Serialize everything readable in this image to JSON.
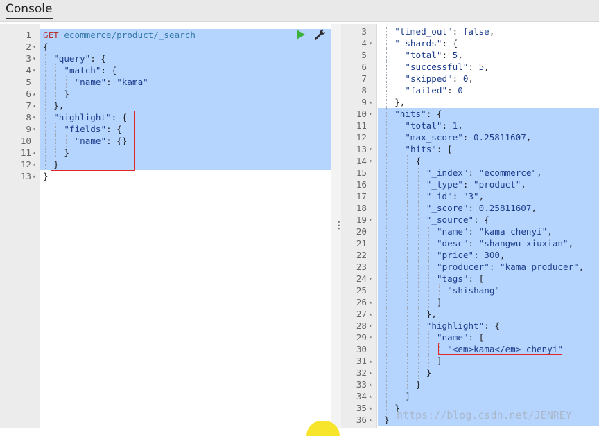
{
  "tab": {
    "label": "Console"
  },
  "request": {
    "lines": [
      {
        "n": "1",
        "fold": "",
        "indent": 0,
        "segs": [
          [
            "m",
            "GET"
          ],
          [
            "b",
            " "
          ],
          [
            "u",
            "ecommerce/product/_search"
          ]
        ],
        "active": true
      },
      {
        "n": "2",
        "fold": "▾",
        "indent": 0,
        "segs": [
          [
            "b",
            "{"
          ]
        ]
      },
      {
        "n": "3",
        "fold": "▾",
        "indent": 1,
        "segs": [
          [
            "k",
            "\"query\""
          ],
          [
            "b",
            ": {"
          ]
        ]
      },
      {
        "n": "4",
        "fold": "▾",
        "indent": 2,
        "segs": [
          [
            "k",
            "\"match\""
          ],
          [
            "b",
            ": {"
          ]
        ]
      },
      {
        "n": "5",
        "fold": "",
        "indent": 3,
        "segs": [
          [
            "k",
            "\"name\""
          ],
          [
            "b",
            ": "
          ],
          [
            "s",
            "\"kama\""
          ]
        ]
      },
      {
        "n": "6",
        "fold": "▴",
        "indent": 2,
        "segs": [
          [
            "b",
            "}"
          ]
        ]
      },
      {
        "n": "7",
        "fold": "▴",
        "indent": 1,
        "segs": [
          [
            "b",
            "},"
          ]
        ]
      },
      {
        "n": "8",
        "fold": "▾",
        "indent": 1,
        "segs": [
          [
            "k",
            "\"highlight\""
          ],
          [
            "b",
            ": {"
          ]
        ]
      },
      {
        "n": "9",
        "fold": "▾",
        "indent": 2,
        "segs": [
          [
            "k",
            "\"fields\""
          ],
          [
            "b",
            ": {"
          ]
        ]
      },
      {
        "n": "10",
        "fold": "",
        "indent": 3,
        "segs": [
          [
            "k",
            "\"name\""
          ],
          [
            "b",
            ": {}"
          ]
        ]
      },
      {
        "n": "11",
        "fold": "▴",
        "indent": 2,
        "segs": [
          [
            "b",
            "}"
          ]
        ]
      },
      {
        "n": "12",
        "fold": "▴",
        "indent": 1,
        "segs": [
          [
            "b",
            "}"
          ]
        ]
      },
      {
        "n": "13",
        "fold": "▴",
        "indent": 0,
        "segs": [
          [
            "b",
            "}"
          ]
        ],
        "nohl": true
      }
    ]
  },
  "response": {
    "lines": [
      {
        "n": "3",
        "fold": "",
        "indent": 1,
        "segs": [
          [
            "k",
            "\"timed_out\""
          ],
          [
            "b",
            ": "
          ],
          [
            "n",
            "false"
          ],
          [
            "b",
            ","
          ]
        ],
        "nohl": true
      },
      {
        "n": "4",
        "fold": "▾",
        "indent": 1,
        "segs": [
          [
            "k",
            "\"_shards\""
          ],
          [
            "b",
            ": {"
          ]
        ],
        "nohl": true
      },
      {
        "n": "5",
        "fold": "",
        "indent": 2,
        "segs": [
          [
            "k",
            "\"total\""
          ],
          [
            "b",
            ": "
          ],
          [
            "n",
            "5"
          ],
          [
            "b",
            ","
          ]
        ],
        "nohl": true
      },
      {
        "n": "6",
        "fold": "",
        "indent": 2,
        "segs": [
          [
            "k",
            "\"successful\""
          ],
          [
            "b",
            ": "
          ],
          [
            "n",
            "5"
          ],
          [
            "b",
            ","
          ]
        ],
        "nohl": true
      },
      {
        "n": "7",
        "fold": "",
        "indent": 2,
        "segs": [
          [
            "k",
            "\"skipped\""
          ],
          [
            "b",
            ": "
          ],
          [
            "n",
            "0"
          ],
          [
            "b",
            ","
          ]
        ],
        "nohl": true
      },
      {
        "n": "8",
        "fold": "",
        "indent": 2,
        "segs": [
          [
            "k",
            "\"failed\""
          ],
          [
            "b",
            ": "
          ],
          [
            "n",
            "0"
          ]
        ],
        "nohl": true
      },
      {
        "n": "9",
        "fold": "▴",
        "indent": 1,
        "segs": [
          [
            "b",
            "},"
          ]
        ],
        "nohl": true
      },
      {
        "n": "10",
        "fold": "▾",
        "indent": 1,
        "segs": [
          [
            "k",
            "\"hits\""
          ],
          [
            "b",
            ": {"
          ]
        ]
      },
      {
        "n": "11",
        "fold": "",
        "indent": 2,
        "segs": [
          [
            "k",
            "\"total\""
          ],
          [
            "b",
            ": "
          ],
          [
            "n",
            "1"
          ],
          [
            "b",
            ","
          ]
        ]
      },
      {
        "n": "12",
        "fold": "",
        "indent": 2,
        "segs": [
          [
            "k",
            "\"max_score\""
          ],
          [
            "b",
            ": "
          ],
          [
            "n",
            "0.25811607"
          ],
          [
            "b",
            ","
          ]
        ]
      },
      {
        "n": "13",
        "fold": "▾",
        "indent": 2,
        "segs": [
          [
            "k",
            "\"hits\""
          ],
          [
            "b",
            ": ["
          ]
        ]
      },
      {
        "n": "14",
        "fold": "▾",
        "indent": 3,
        "segs": [
          [
            "b",
            "{"
          ]
        ]
      },
      {
        "n": "15",
        "fold": "",
        "indent": 4,
        "segs": [
          [
            "k",
            "\"_index\""
          ],
          [
            "b",
            ": "
          ],
          [
            "s",
            "\"ecommerce\""
          ],
          [
            "b",
            ","
          ]
        ]
      },
      {
        "n": "16",
        "fold": "",
        "indent": 4,
        "segs": [
          [
            "k",
            "\"_type\""
          ],
          [
            "b",
            ": "
          ],
          [
            "s",
            "\"product\""
          ],
          [
            "b",
            ","
          ]
        ]
      },
      {
        "n": "17",
        "fold": "",
        "indent": 4,
        "segs": [
          [
            "k",
            "\"_id\""
          ],
          [
            "b",
            ": "
          ],
          [
            "s",
            "\"3\""
          ],
          [
            "b",
            ","
          ]
        ]
      },
      {
        "n": "18",
        "fold": "",
        "indent": 4,
        "segs": [
          [
            "k",
            "\"_score\""
          ],
          [
            "b",
            ": "
          ],
          [
            "n",
            "0.25811607"
          ],
          [
            "b",
            ","
          ]
        ]
      },
      {
        "n": "19",
        "fold": "▾",
        "indent": 4,
        "segs": [
          [
            "k",
            "\"_source\""
          ],
          [
            "b",
            ": {"
          ]
        ]
      },
      {
        "n": "20",
        "fold": "",
        "indent": 5,
        "segs": [
          [
            "k",
            "\"name\""
          ],
          [
            "b",
            ": "
          ],
          [
            "s",
            "\"kama chenyi\""
          ],
          [
            "b",
            ","
          ]
        ]
      },
      {
        "n": "21",
        "fold": "",
        "indent": 5,
        "segs": [
          [
            "k",
            "\"desc\""
          ],
          [
            "b",
            ": "
          ],
          [
            "s",
            "\"shangwu xiuxian\""
          ],
          [
            "b",
            ","
          ]
        ]
      },
      {
        "n": "22",
        "fold": "",
        "indent": 5,
        "segs": [
          [
            "k",
            "\"price\""
          ],
          [
            "b",
            ": "
          ],
          [
            "n",
            "300"
          ],
          [
            "b",
            ","
          ]
        ]
      },
      {
        "n": "23",
        "fold": "",
        "indent": 5,
        "segs": [
          [
            "k",
            "\"producer\""
          ],
          [
            "b",
            ": "
          ],
          [
            "s",
            "\"kama producer\""
          ],
          [
            "b",
            ","
          ]
        ]
      },
      {
        "n": "24",
        "fold": "▾",
        "indent": 5,
        "segs": [
          [
            "k",
            "\"tags\""
          ],
          [
            "b",
            ": ["
          ]
        ]
      },
      {
        "n": "25",
        "fold": "",
        "indent": 6,
        "segs": [
          [
            "s",
            "\"shishang\""
          ]
        ]
      },
      {
        "n": "26",
        "fold": "▴",
        "indent": 5,
        "segs": [
          [
            "b",
            "]"
          ]
        ]
      },
      {
        "n": "27",
        "fold": "▴",
        "indent": 4,
        "segs": [
          [
            "b",
            "},"
          ]
        ]
      },
      {
        "n": "28",
        "fold": "▾",
        "indent": 4,
        "segs": [
          [
            "k",
            "\"highlight\""
          ],
          [
            "b",
            ": {"
          ]
        ]
      },
      {
        "n": "29",
        "fold": "▾",
        "indent": 5,
        "segs": [
          [
            "k",
            "\"name\""
          ],
          [
            "b",
            ": ["
          ]
        ]
      },
      {
        "n": "30",
        "fold": "",
        "indent": 6,
        "segs": [
          [
            "s",
            "\"<em>kama</em> chenyi\""
          ]
        ]
      },
      {
        "n": "31",
        "fold": "▴",
        "indent": 5,
        "segs": [
          [
            "b",
            "]"
          ]
        ]
      },
      {
        "n": "32",
        "fold": "▴",
        "indent": 4,
        "segs": [
          [
            "b",
            "}"
          ]
        ]
      },
      {
        "n": "33",
        "fold": "▴",
        "indent": 3,
        "segs": [
          [
            "b",
            "}"
          ]
        ]
      },
      {
        "n": "34",
        "fold": "▴",
        "indent": 2,
        "segs": [
          [
            "b",
            "]"
          ]
        ]
      },
      {
        "n": "35",
        "fold": "▴",
        "indent": 1,
        "segs": [
          [
            "b",
            "}"
          ]
        ]
      },
      {
        "n": "36",
        "fold": "▴",
        "indent": 0,
        "segs": [
          [
            "b",
            "}"
          ]
        ]
      }
    ]
  },
  "watermark": "https://blog.csdn.net/JENREY",
  "colors": {
    "selection": "#b5d5ff",
    "accent_red": "#e12727",
    "run_green": "#3cb23c"
  }
}
